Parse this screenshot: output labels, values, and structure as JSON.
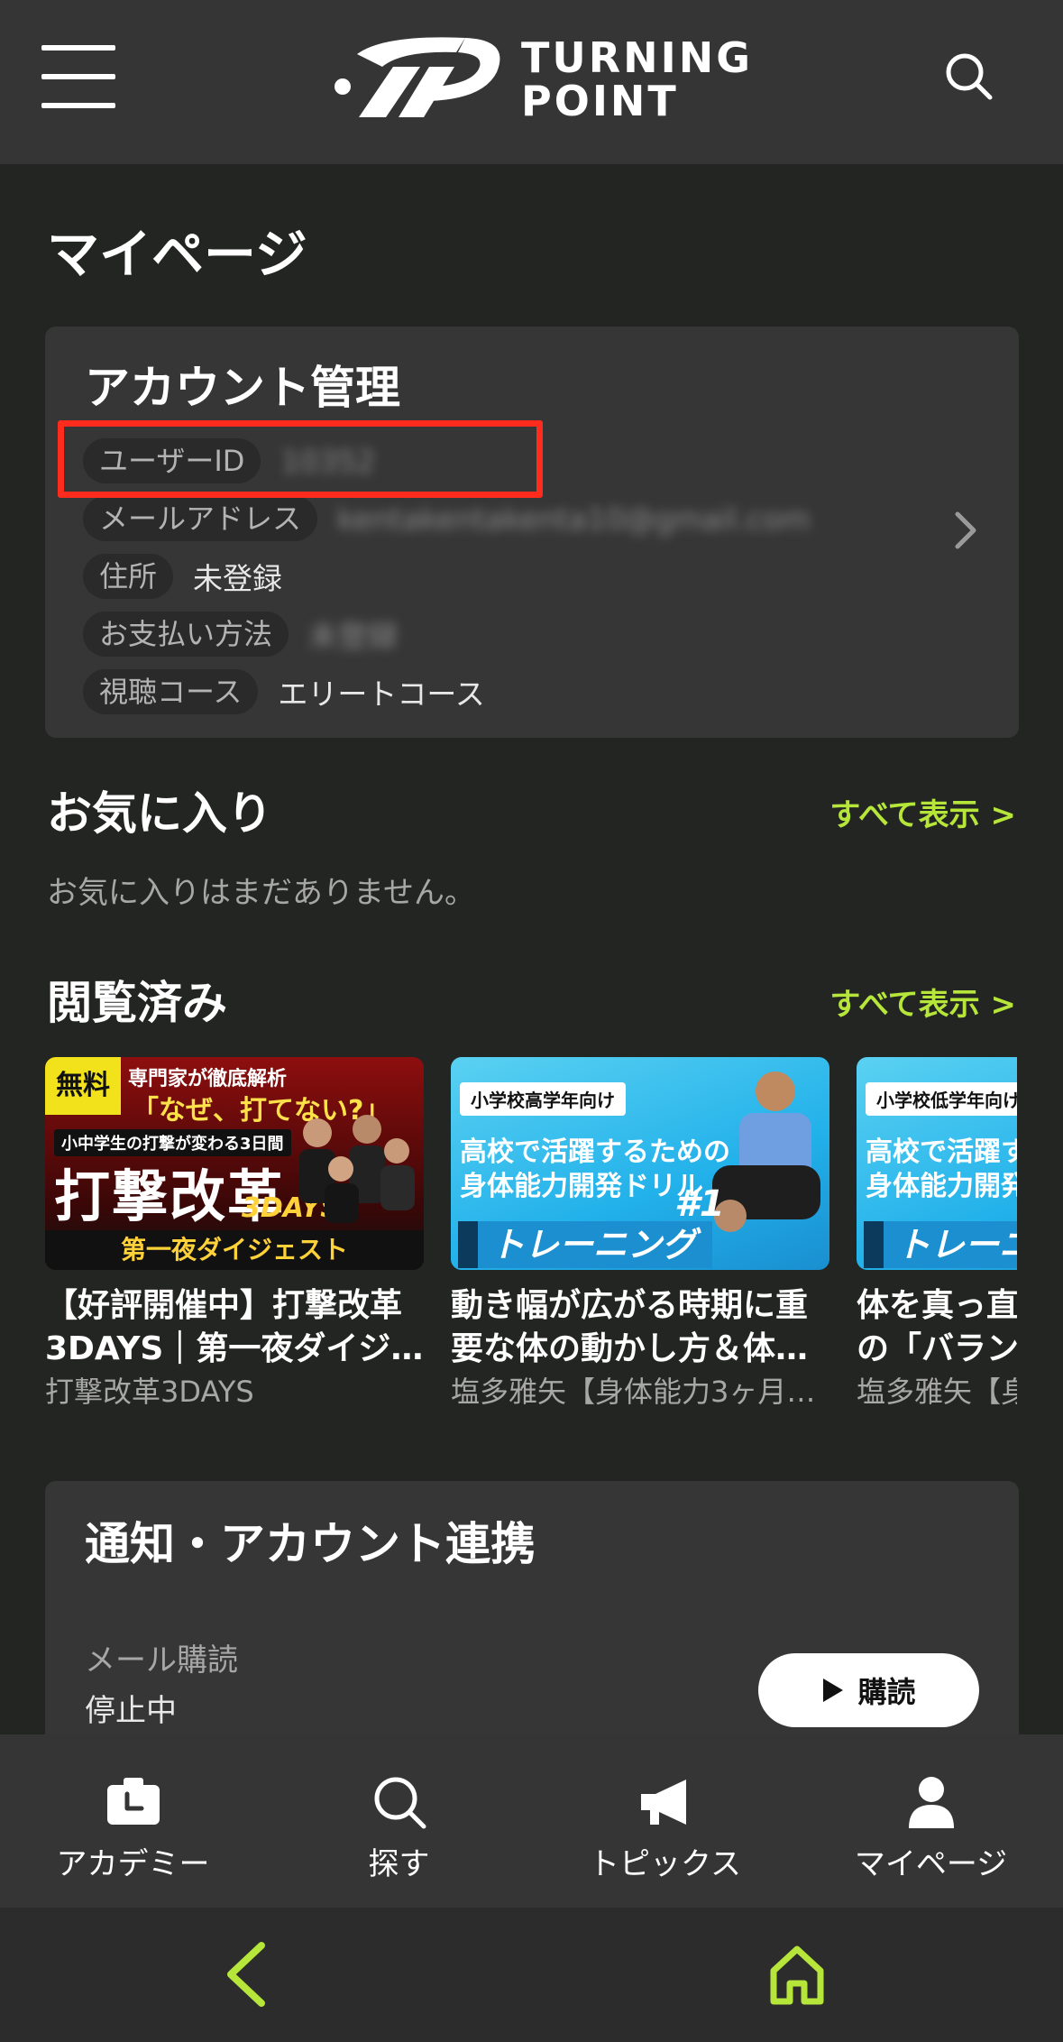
{
  "header": {
    "logo_text_line1": "TURNING",
    "logo_text_line2": "POINT",
    "icons": {
      "menu": "hamburger-menu-icon",
      "search": "search-icon"
    }
  },
  "page_title": "マイページ",
  "account": {
    "title": "アカウント管理",
    "rows": [
      {
        "label": "ユーザーID",
        "value": "10352",
        "blurred": true
      },
      {
        "label": "メールアドレス",
        "value": "kentakentakenta10@gmail.com",
        "blurred": true
      },
      {
        "label": "住所",
        "value": "未登録",
        "blurred": false
      },
      {
        "label": "お支払い方法",
        "value": "未登録",
        "blurred": true
      },
      {
        "label": "視聴コース",
        "value": "エリートコース",
        "blurred": false
      }
    ],
    "highlight_color": "#ff2b1c"
  },
  "favorites": {
    "title": "お気に入り",
    "see_all": "すべて表示 >",
    "empty_text": "お気に入りはまだありません。"
  },
  "history": {
    "title": "閲覧済み",
    "see_all": "すべて表示 >",
    "videos": [
      {
        "title": "【好評開催中】打撃改革3DAYS｜第一夜ダイジ…",
        "subtitle": "打撃改革3DAYS",
        "thumb": {
          "badge": "無料",
          "top": "専門家が徹底解析",
          "quote": "「なぜ、打てない?」",
          "mid": "小中学生の打撃が変わる3日間",
          "big": "打撃改革",
          "days": "3DAYS",
          "footer": "第一夜ダイジェスト"
        }
      },
      {
        "title": "動き幅が広がる時期に重要な体の動かし方＆体…",
        "subtitle": "塩多雅矢【身体能力3ヶ月…",
        "thumb": {
          "tag": "小学校高学年向け",
          "line1": "高校で活躍するための",
          "line2": "身体能力開発ドリル",
          "banner": "トレーニング",
          "num": "#1"
        }
      },
      {
        "title": "体を真っ直ぐに保つための「バランス",
        "subtitle": "塩多雅矢【身",
        "thumb": {
          "tag": "小学校低学年向け",
          "line1": "高校で活躍するための",
          "line2": "身体能力開発ドリル",
          "banner": "トレーニング"
        }
      }
    ]
  },
  "notifications": {
    "title": "通知・アカウント連携",
    "mail_label": "メール購読",
    "mail_status": "停止中",
    "subscribe_button": "購読"
  },
  "tabbar": {
    "items": [
      {
        "label": "アカデミー",
        "icon": "academy-icon"
      },
      {
        "label": "探す",
        "icon": "search-icon"
      },
      {
        "label": "トピックス",
        "icon": "megaphone-icon"
      },
      {
        "label": "マイページ",
        "icon": "person-icon"
      }
    ]
  },
  "colors": {
    "accent": "#b7e63a",
    "background": "#232522",
    "card": "#363636",
    "header": "#353535"
  }
}
